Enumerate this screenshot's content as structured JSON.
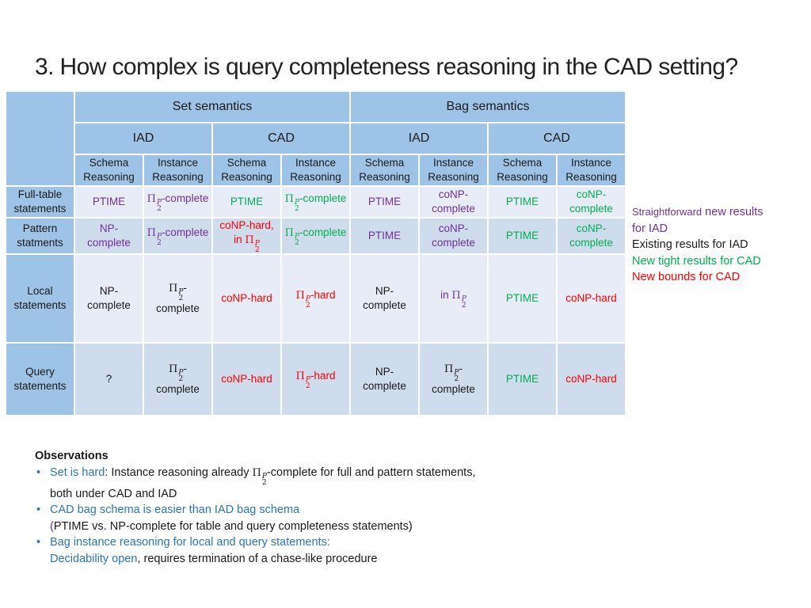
{
  "title": "3. How complex is query completeness reasoning in the CAD setting?",
  "colors": {
    "header_bg": "#9dc3e6",
    "row_light": "#e8ecf6",
    "row_dark": "#cfdcec",
    "purple": "#7030a0",
    "green": "#00b050",
    "red": "#ff0000",
    "blue": "#2e75b6"
  },
  "table": {
    "semantics": [
      "Set semantics",
      "Bag semantics"
    ],
    "settings": [
      "IAD",
      "CAD",
      "IAD",
      "CAD"
    ],
    "reasoning": [
      {
        "line1": "Schema",
        "line2": "Reasoning"
      },
      {
        "line1": "Instance",
        "line2": "Reasoning"
      },
      {
        "line1": "Schema",
        "line2": "Reasoning"
      },
      {
        "line1": "Instance",
        "line2": "Reasoning"
      },
      {
        "line1": "Schema",
        "line2": "Reasoning"
      },
      {
        "line1": "Instance",
        "line2": "Reasoning"
      },
      {
        "line1": "Schema",
        "line2": "Reasoning"
      },
      {
        "line1": "Instance",
        "line2": "Reasoning"
      }
    ],
    "pi_symbol": "Π",
    "pi_sup": "P",
    "pi_sub": "2",
    "rows": [
      {
        "label1": "Full-table",
        "label2": "statements",
        "cells": [
          {
            "text": "PTIME",
            "color": "purple"
          },
          {
            "pi_prefix": "",
            "text": "-complete",
            "color": "purple",
            "pi": true
          },
          {
            "text": "PTIME",
            "color": "green"
          },
          {
            "pi_prefix": "",
            "text": "-complete",
            "color": "green",
            "pi": true
          },
          {
            "text": "PTIME",
            "color": "purple"
          },
          {
            "line1": "coNP-",
            "line2": "complete",
            "color": "purple"
          },
          {
            "text": "PTIME",
            "color": "green"
          },
          {
            "line1": "coNP-",
            "line2": "complete",
            "color": "green"
          }
        ]
      },
      {
        "label1": "Pattern",
        "label2": "statments",
        "cells": [
          {
            "line1": "NP-",
            "line2": "complete",
            "color": "purple"
          },
          {
            "text": "-complete",
            "color": "purple",
            "pi": true
          },
          {
            "line1": "coNP-hard,",
            "line2": "in ",
            "color": "red",
            "pi_line2": true
          },
          {
            "text": "-complete",
            "color": "green",
            "pi": true
          },
          {
            "text": "PTIME",
            "color": "purple"
          },
          {
            "line1": "coNP-",
            "line2": "complete",
            "color": "purple"
          },
          {
            "text": "PTIME",
            "color": "green"
          },
          {
            "line1": "coNP-",
            "line2": "complete",
            "color": "green"
          }
        ]
      },
      {
        "label1": "Local",
        "label2": "statements",
        "cells": [
          {
            "line1": "NP-",
            "line2": "complete",
            "color": "black"
          },
          {
            "line1": "-",
            "line2": "complete",
            "color": "black",
            "pi_line1": true
          },
          {
            "text": "coNP-hard",
            "color": "red"
          },
          {
            "text": "-hard",
            "color": "red",
            "pi": true
          },
          {
            "line1": "NP-",
            "line2": "complete",
            "color": "black"
          },
          {
            "text": "in ",
            "color": "purple",
            "pi_after": true
          },
          {
            "text": "PTIME",
            "color": "green"
          },
          {
            "text": "coNP-hard",
            "color": "red"
          }
        ]
      },
      {
        "label1": "Query",
        "label2": "statements",
        "cells": [
          {
            "text": "?",
            "color": "black"
          },
          {
            "line1": "-",
            "line2": "complete",
            "color": "black",
            "pi_line1": true
          },
          {
            "text": "coNP-hard",
            "color": "red"
          },
          {
            "text": "-hard",
            "color": "red",
            "pi": true
          },
          {
            "line1": "NP-",
            "line2": "complete",
            "color": "black"
          },
          {
            "line1": "-",
            "line2": "complete",
            "color": "black",
            "pi_line1": true
          },
          {
            "text": "PTIME",
            "color": "green"
          },
          {
            "text": "coNP-hard",
            "color": "red"
          }
        ]
      }
    ]
  },
  "legend": {
    "items": [
      {
        "text": "Straightforward new results",
        "text_small": "Straightforward",
        "text_rest": " new results",
        "color": "purple"
      },
      {
        "text": "for IAD",
        "color": "purple"
      },
      {
        "text": "Existing results for IAD",
        "color": "black"
      },
      {
        "text": "New tight results for CAD",
        "color": "green"
      },
      {
        "text": "New bounds for CAD",
        "color": "red"
      }
    ]
  },
  "observations": {
    "heading": "Observations",
    "items": [
      {
        "highlight": "Set is hard",
        "text_a": ": Instance reasoning already ",
        "text_b": "-complete for full and pattern statements,",
        "line2": "both under CAD and IAD"
      },
      {
        "highlight": "CAD bag schema is easier than IAD bag schema",
        "paren_open": "(",
        "line2": "PTIME vs. NP-complete for table and query completeness statements)"
      },
      {
        "highlight": "Bag instance reasoning for local and query statements:",
        "line2_highlight": "Decidability open",
        "line2": ", requires termination of a chase-like procedure"
      }
    ]
  }
}
